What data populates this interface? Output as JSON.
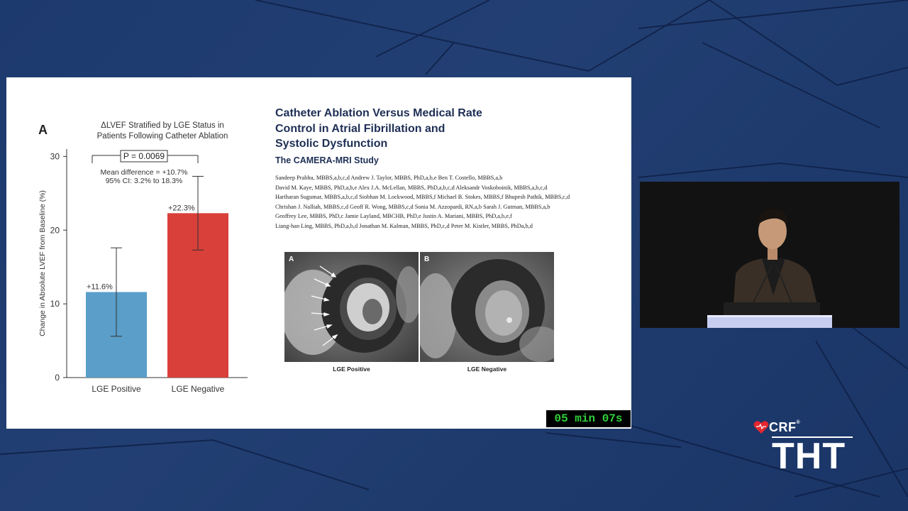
{
  "slide": {
    "panel_letter": "A",
    "chart_title_line1": "ΔLVEF Stratified by LGE Status in",
    "chart_title_line2": "Patients Following Catheter Ablation",
    "paper_title_line1": "Catheter Ablation Versus Medical Rate",
    "paper_title_line2": "Control in Atrial Fibrillation and",
    "paper_title_line3": "Systolic Dysfunction",
    "paper_subtitle": "The CAMERA-MRI Study",
    "authors": [
      "Sandeep Prabhu, MBBS,a,b,c,d Andrew J. Taylor, MBBS, PhD,a,b,e Ben T. Costello, MBBS,a,b",
      "David M. Kaye, MBBS, PhD,a,b,e Alex J.A. McLellan, MBBS, PhD,a,b,c,d Aleksandr Voskoboinik, MBBS,a,b,c,d",
      "Hariharan Sugumar, MBBS,a,b,c,d Siobhan M. Lockwood, MBBS,f Michael B. Stokes, MBBS,f Bhupesh Pathik, MBBS,c,d",
      "Chrishan J. Nalliah, MBBS,c,d Geoff R. Wong, MBBS,c,d Sonia M. Azzopardi, RN,a,b Sarah J. Gutman, MBBS,a,b",
      "Geoffrey Lee, MBBS, PhD,c Jamie Layland, MBCHB, PhD,e Justin A. Mariani, MBBS, PhD,a,b,e,f",
      "Liang-han Ling, MBBS, PhD,a,b,d Jonathan M. Kalman, MBBS, PhD,c,d Peter M. Kistler, MBBS, PhDa,b,d"
    ],
    "mri_a_letter": "A",
    "mri_b_letter": "B",
    "mri_a_caption": "LGE Positive",
    "mri_b_caption": "LGE Negative"
  },
  "timer": {
    "text": "05 min 07s",
    "color": "#2fd13a"
  },
  "logo": {
    "crf": "CRF",
    "crf_mark": "®",
    "tht": "THT",
    "heart_color": "#e3262f"
  },
  "colors": {
    "bar_positive": "#5a9ec9",
    "bar_negative": "#d9403a",
    "title_navy": "#1e2f55"
  },
  "chart_data": {
    "type": "bar",
    "categories": [
      "LGE Positive",
      "LGE Negative"
    ],
    "values": [
      11.6,
      22.3
    ],
    "value_labels": [
      "+11.6%",
      "+22.3%"
    ],
    "ci_low": [
      5.6,
      17.3
    ],
    "ci_high": [
      17.6,
      27.3
    ],
    "ylabel": "Change in Absolute LVEF from Baseline (%)",
    "ylim": [
      0,
      31
    ],
    "yticks": [
      0,
      10,
      20,
      30
    ],
    "p_value": "P = 0.0069",
    "mean_diff": "Mean difference = +10.7%",
    "ci_text": "95% CI: 3.2% to 18.3%",
    "grid": false
  }
}
